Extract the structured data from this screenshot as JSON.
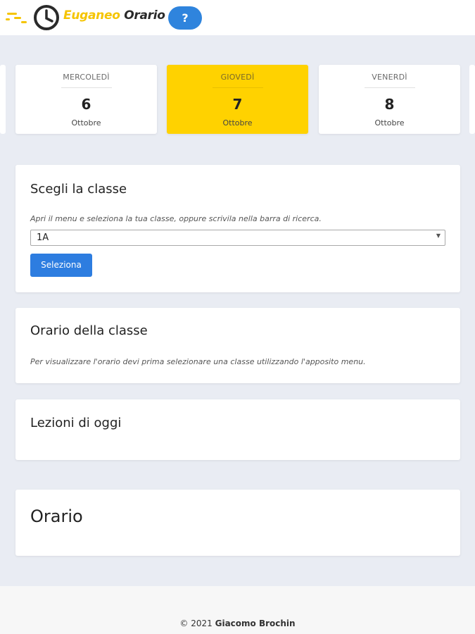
{
  "header": {
    "brand_part1": "Euganeo",
    "brand_part2": "Orario",
    "help_label": "?"
  },
  "days": [
    {
      "name": "MERCOLEDÌ",
      "number": "6",
      "month": "Ottobre",
      "active": false
    },
    {
      "name": "GIOVEDÌ",
      "number": "7",
      "month": "Ottobre",
      "active": true
    },
    {
      "name": "VENERDÌ",
      "number": "8",
      "month": "Ottobre",
      "active": false
    }
  ],
  "class_panel": {
    "title": "Scegli la classe",
    "description": "Apri il menu e seleziona la tua classe, oppure scrivila nella barra di ricerca.",
    "selected_value": "1A",
    "button_label": "Seleziona"
  },
  "schedule_panel": {
    "title": "Orario della classe",
    "description": "Per visualizzare l'orario devi prima selezionare una classe utilizzando l'apposito menu."
  },
  "lessons_panel": {
    "title": "Lezioni di oggi"
  },
  "orario_panel": {
    "title": "Orario"
  },
  "footer": {
    "prefix": "© 2021",
    "author": "Giacomo Brochin"
  },
  "colors": {
    "accent": "#ffd200",
    "primary": "#2d7de0",
    "background": "#e9ecf3"
  }
}
